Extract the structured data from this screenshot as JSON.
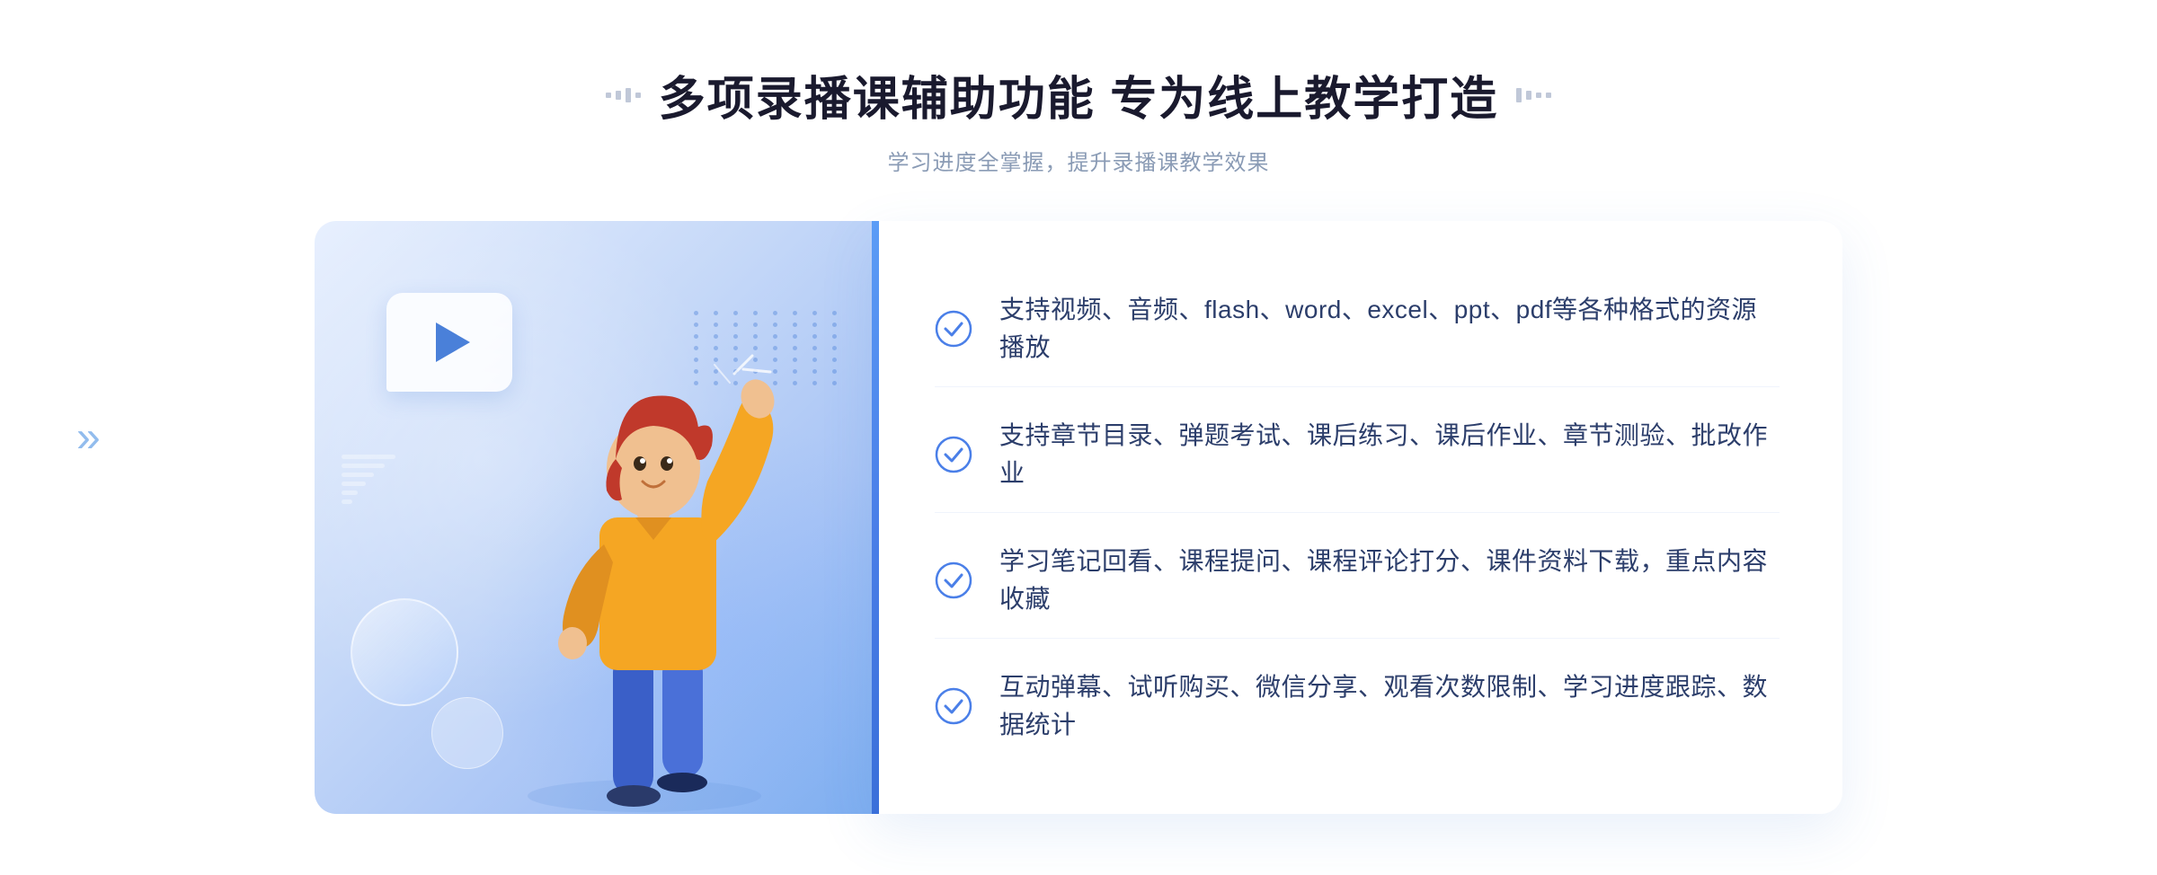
{
  "page": {
    "background_color": "#ffffff"
  },
  "header": {
    "title": "多项录播课辅助功能 专为线上教学打造",
    "subtitle": "学习进度全掌握，提升录播课教学效果",
    "decoration_left": "❮❮",
    "decoration_right": "❯❯"
  },
  "features": [
    {
      "id": 1,
      "text": "支持视频、音频、flash、word、excel、ppt、pdf等各种格式的资源播放"
    },
    {
      "id": 2,
      "text": "支持章节目录、弹题考试、课后练习、课后作业、章节测验、批改作业"
    },
    {
      "id": 3,
      "text": "学习笔记回看、课程提问、课程评论打分、课件资料下载，重点内容收藏"
    },
    {
      "id": 4,
      "text": "互动弹幕、试听购买、微信分享、观看次数限制、学习进度跟踪、数据统计"
    }
  ],
  "colors": {
    "primary_blue": "#4a7fe8",
    "light_blue": "#e8f0fe",
    "text_dark": "#2c3e6b",
    "text_gray": "#8a9bb5",
    "check_color": "#4a7fe8"
  }
}
